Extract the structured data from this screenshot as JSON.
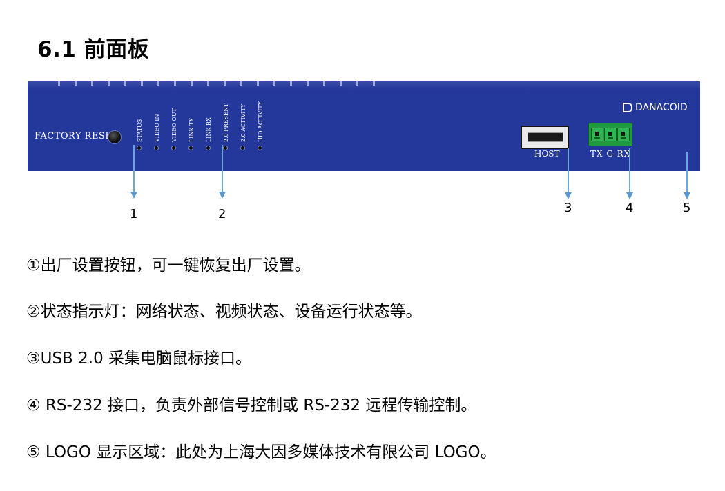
{
  "title": "6.1 前面板",
  "panel": {
    "factory_reset_label": "FACTORY RESET",
    "leds": [
      "STATUS",
      "VIDEO IN",
      "VIDEO OUT",
      "LINK TX",
      "LINK RX",
      "2.0 PRESENT",
      "2.0 ACTIVITY",
      "HID ACTIVITY"
    ],
    "host_label": "HOST",
    "rs232_label": "TX  G  RX",
    "logo_text": "DANACOID",
    "panel_color": "#24379a",
    "terminal_color": "#1f9a3e"
  },
  "callouts": [
    "1",
    "2",
    "3",
    "4",
    "5"
  ],
  "descriptions": [
    "①出厂设置按钮，可一键恢复出厂设置。",
    "②状态指示灯：网络状态、视频状态、设备运行状态等。",
    "③USB 2.0 采集电脑鼠标接口。",
    "④  RS-232  接口，负责外部信号控制或 RS-232 远程传输控制。",
    "⑤  LOGO 显示区域：此处为上海大因多媒体技术有限公司 LOGO。"
  ],
  "callout_color": "#5a96cf"
}
